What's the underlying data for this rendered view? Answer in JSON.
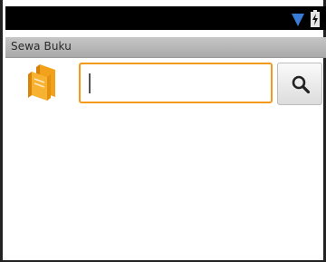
{
  "app": {
    "title": "Sewa Buku"
  },
  "status_bar": {
    "icons": [
      "wifi-icon",
      "battery-icon"
    ]
  },
  "search": {
    "value": "",
    "placeholder": "",
    "button_icon": "search-icon"
  },
  "logo": {
    "icon": "books-icon"
  },
  "colors": {
    "accent": "#f39a1c",
    "status_bar": "#000000",
    "title_bar": "#b3b3b3",
    "wifi": "#3a7bd5"
  }
}
